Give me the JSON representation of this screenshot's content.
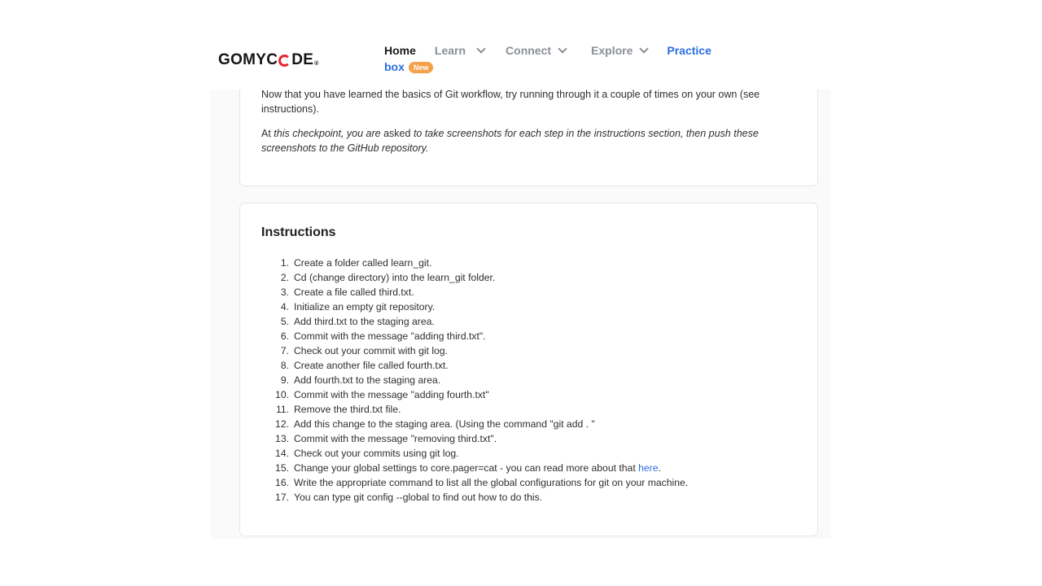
{
  "header": {
    "logo": {
      "part1": "GOMYC",
      "part2": "DE",
      "reg": "®"
    },
    "nav": {
      "home": "Home",
      "learn": "Learn",
      "connect": "Connect",
      "explore": "Explore",
      "practice": "Practice",
      "box": "box",
      "new_badge": "New"
    }
  },
  "intro": {
    "para1": "Now that you have learned the basics of Git workflow, try running through it a couple of times on your own (see instructions).",
    "para2_start": "At ",
    "para2_em1": "this checkpoint, you are",
    "para2_mid": " asked ",
    "para2_em2": "to take screenshots for each step in the instructions section, then push these screenshots to the GitHub repository."
  },
  "instructions": {
    "title": "Instructions",
    "steps": [
      {
        "n": "1.",
        "text": "Create a folder called learn_git."
      },
      {
        "n": "2.",
        "text": "Cd (change directory) into the learn_git folder."
      },
      {
        "n": "3.",
        "text": "Create a file called third.txt."
      },
      {
        "n": "4.",
        "text": "Initialize an empty git repository."
      },
      {
        "n": "5.",
        "text": "Add third.txt to the staging area."
      },
      {
        "n": "6.",
        "text": "Commit with the message \"adding third.txt\"."
      },
      {
        "n": "7.",
        "text": "Check out your commit with git log."
      },
      {
        "n": "8.",
        "text": "Create another file called fourth.txt."
      },
      {
        "n": "9.",
        "text": "Add fourth.txt to the staging area."
      },
      {
        "n": "10.",
        "text": "Commit with the message \"adding fourth.txt\""
      },
      {
        "n": "11.",
        "text": "Remove the third.txt file."
      },
      {
        "n": "12.",
        "text": "Add this change to the staging area. (Using the command \"git add . \""
      },
      {
        "n": "13.",
        "text": "Commit with the message \"removing third.txt\"."
      },
      {
        "n": "14.",
        "text": "Check out your commits using git log."
      },
      {
        "n": "15.",
        "text": "Change your global settings to core.pager=cat - you can read more about that ",
        "link": "here",
        "after": "."
      },
      {
        "n": "16.",
        "text": "Write the appropriate command to list all the global configurations for git on your machine."
      },
      {
        "n": "17.",
        "text": "You can type git config --global to find out how to do this."
      }
    ]
  },
  "colors": {
    "accent": "#2a6fe0",
    "badge": "#f5a04a",
    "brand_red": "#e8262e"
  }
}
